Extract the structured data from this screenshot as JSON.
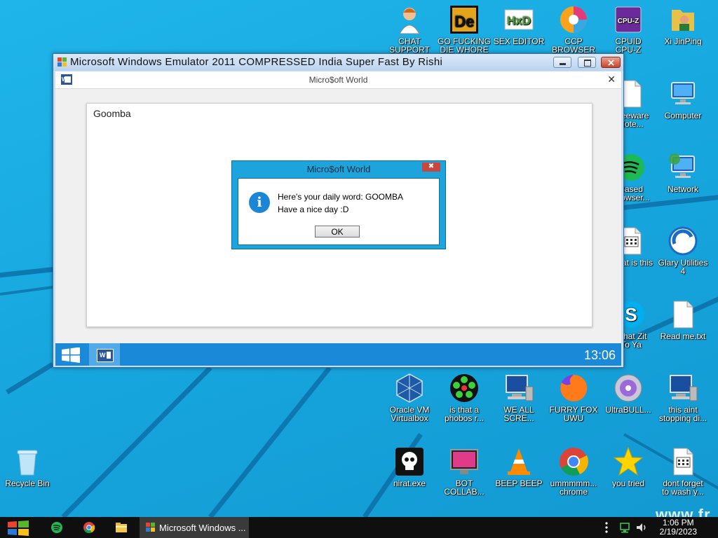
{
  "desktop": {
    "icons": [
      {
        "id": "chat-support",
        "label": "CHAT\nSUPPORT",
        "icon": "chat-support-icon",
        "color": "#e07a2a"
      },
      {
        "id": "go-fucking",
        "label": "GO FUCKING\nDIE WHORE",
        "icon": "dll-editor-icon",
        "color": "#e3a51c"
      },
      {
        "id": "sex-editor",
        "label": "SEX EDITOR",
        "icon": "hex-editor-icon",
        "color": "#4a9e3a"
      },
      {
        "id": "ccp-browser",
        "label": "CCP\nBROWSER",
        "icon": "colorful-browser-icon",
        "color": "#e23b7a"
      },
      {
        "id": "cpuid",
        "label": "CPUID\nCPU-Z",
        "icon": "cpu-z-icon",
        "color": "#6a2a9a"
      },
      {
        "id": "xi-jinping",
        "label": "Xi JinPing",
        "icon": "user-folder-icon",
        "color": "#e8c14a"
      },
      {
        "id": "freeware-note",
        "label": "Freeware\nNote...",
        "icon": "document-icon",
        "color": "#ffffff"
      },
      {
        "id": "computer",
        "label": "Computer",
        "icon": "computer-icon",
        "color": "#2c74c9"
      },
      {
        "id": "based-browser",
        "label": "Based\nBrowser...",
        "icon": "green-app-icon",
        "color": "#1db954"
      },
      {
        "id": "network",
        "label": "Network",
        "icon": "network-icon",
        "color": "#2c74c9"
      },
      {
        "id": "what-is-this",
        "label": "What is this",
        "icon": "calendar-file-icon",
        "color": "#ffffff"
      },
      {
        "id": "glary",
        "label": "Glary Utilities\n4",
        "icon": "glary-icon",
        "color": "#1a6bc4"
      },
      {
        "id": "what-zit",
        "label": "What Zit\nTo Ya",
        "icon": "skype-icon",
        "color": "#00aff0"
      },
      {
        "id": "read-me",
        "label": "Read me.txt",
        "icon": "text-file-icon",
        "color": "#ffffff"
      },
      {
        "id": "oracle-vm",
        "label": "Oracle VM\nVirtualbox",
        "icon": "virtualbox-icon",
        "color": "#1d5ba8"
      },
      {
        "id": "phobos",
        "label": "is that a\nphobos r...",
        "icon": "icq-flower-icon",
        "color": "#3bd13b"
      },
      {
        "id": "we-all-scream",
        "label": "WE ALL\nSCRE...",
        "icon": "computer-error-icon",
        "color": "#1a4fa0"
      },
      {
        "id": "furry-fox",
        "label": "FURRY FOX\nUWU",
        "icon": "firefox-icon",
        "color": "#ff7a1a"
      },
      {
        "id": "ultrabull",
        "label": "UltraBULL...",
        "icon": "disc-icon",
        "color": "#8a4ad0"
      },
      {
        "id": "this-aint",
        "label": "this aint\nstopping di...",
        "icon": "computer-repair-icon",
        "color": "#7aa0c8"
      },
      {
        "id": "recycle-bin",
        "label": "Recycle Bin",
        "icon": "recycle-bin-icon",
        "color": "#9ad2f0"
      },
      {
        "id": "nirat",
        "label": "nirat.exe",
        "icon": "skull-icon",
        "color": "#111111"
      },
      {
        "id": "bot-collab",
        "label": "BOT\nCOLLAB...",
        "icon": "monitor-pink-icon",
        "color": "#e03a8a"
      },
      {
        "id": "beep-beep",
        "label": "BEEP BEEP",
        "icon": "vlc-cone-icon",
        "color": "#ff8a00"
      },
      {
        "id": "chrome-shortcut",
        "label": "ummmmm...\nchrome",
        "icon": "chrome-icon",
        "color": "#4285f4"
      },
      {
        "id": "you-tried",
        "label": "you tried",
        "icon": "star-icon",
        "color": "#ffd400"
      },
      {
        "id": "dont-forget",
        "label": "dont forget\nto wash y...",
        "icon": "calendar-file-icon",
        "color": "#ffffff"
      }
    ],
    "watermark": "www.fr"
  },
  "emulator": {
    "title": "Microsoft Windows Emulator 2011 COMPRESSED India Super Fast By Rishi",
    "app_title": "Micro$oft World",
    "document_text": "Goomba",
    "inner_clock": "13:06"
  },
  "dialog": {
    "title": "Micro$oft World",
    "close_label": "✖",
    "line1": "Here's your daily word: GOOMBA",
    "line2": "Have a nice day :D",
    "ok_label": "OK"
  },
  "taskbar": {
    "task_label": "Microsoft Windows ...",
    "time": "1:06 PM",
    "date": "2/19/2023"
  }
}
